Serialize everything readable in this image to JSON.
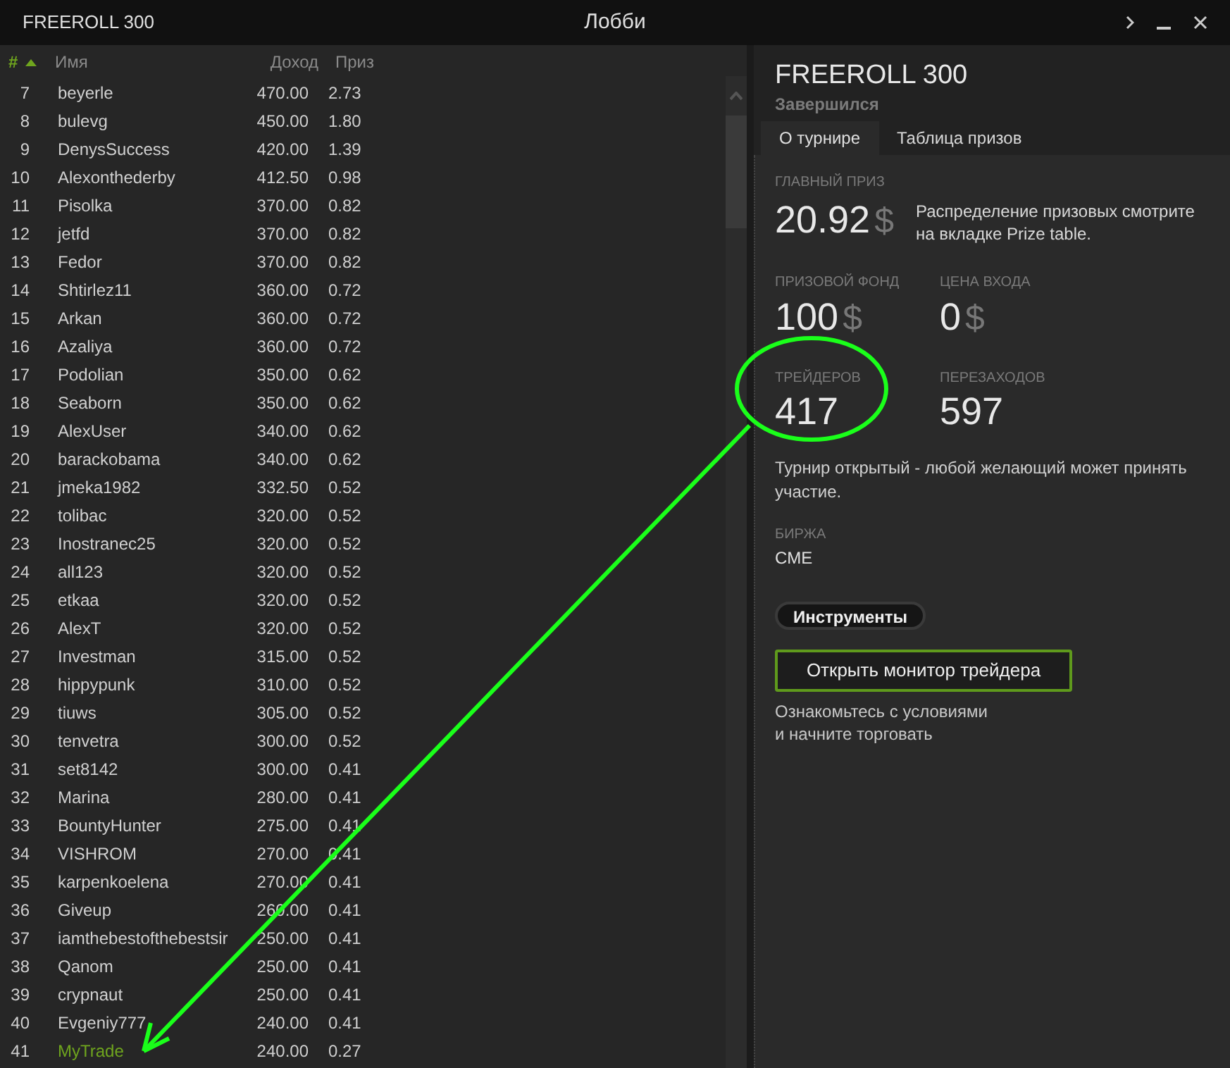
{
  "window": {
    "title": "FREEROLL 300",
    "heading": "Лобби"
  },
  "table": {
    "columns": [
      {
        "label": "#",
        "sorted": true
      },
      {
        "label": "Имя",
        "sorted": false
      },
      {
        "label": "Доход",
        "sorted": false
      },
      {
        "label": "Приз",
        "sorted": false
      }
    ],
    "rows": [
      {
        "rank": "7",
        "name": "beyerle",
        "income": "470.00",
        "prize": "2.73",
        "current": false
      },
      {
        "rank": "8",
        "name": "bulevg",
        "income": "450.00",
        "prize": "1.80",
        "current": false
      },
      {
        "rank": "9",
        "name": "DenysSuccess",
        "income": "420.00",
        "prize": "1.39",
        "current": false
      },
      {
        "rank": "10",
        "name": "Alexonthederby",
        "income": "412.50",
        "prize": "0.98",
        "current": false
      },
      {
        "rank": "11",
        "name": "Pisolka",
        "income": "370.00",
        "prize": "0.82",
        "current": false
      },
      {
        "rank": "12",
        "name": "jetfd",
        "income": "370.00",
        "prize": "0.82",
        "current": false
      },
      {
        "rank": "13",
        "name": "Fedor",
        "income": "370.00",
        "prize": "0.82",
        "current": false
      },
      {
        "rank": "14",
        "name": "Shtirlez11",
        "income": "360.00",
        "prize": "0.72",
        "current": false
      },
      {
        "rank": "15",
        "name": "Arkan",
        "income": "360.00",
        "prize": "0.72",
        "current": false
      },
      {
        "rank": "16",
        "name": "Azaliya",
        "income": "360.00",
        "prize": "0.72",
        "current": false
      },
      {
        "rank": "17",
        "name": "Podolian",
        "income": "350.00",
        "prize": "0.62",
        "current": false
      },
      {
        "rank": "18",
        "name": "Seaborn",
        "income": "350.00",
        "prize": "0.62",
        "current": false
      },
      {
        "rank": "19",
        "name": "AlexUser",
        "income": "340.00",
        "prize": "0.62",
        "current": false
      },
      {
        "rank": "20",
        "name": "barackobama",
        "income": "340.00",
        "prize": "0.62",
        "current": false
      },
      {
        "rank": "21",
        "name": "jmeka1982",
        "income": "332.50",
        "prize": "0.52",
        "current": false
      },
      {
        "rank": "22",
        "name": "tolibac",
        "income": "320.00",
        "prize": "0.52",
        "current": false
      },
      {
        "rank": "23",
        "name": "Inostranec25",
        "income": "320.00",
        "prize": "0.52",
        "current": false
      },
      {
        "rank": "24",
        "name": "all123",
        "income": "320.00",
        "prize": "0.52",
        "current": false
      },
      {
        "rank": "25",
        "name": "etkaa",
        "income": "320.00",
        "prize": "0.52",
        "current": false
      },
      {
        "rank": "26",
        "name": "AlexT",
        "income": "320.00",
        "prize": "0.52",
        "current": false
      },
      {
        "rank": "27",
        "name": "Investman",
        "income": "315.00",
        "prize": "0.52",
        "current": false
      },
      {
        "rank": "28",
        "name": "hippypunk",
        "income": "310.00",
        "prize": "0.52",
        "current": false
      },
      {
        "rank": "29",
        "name": "tiuws",
        "income": "305.00",
        "prize": "0.52",
        "current": false
      },
      {
        "rank": "30",
        "name": "tenvetra",
        "income": "300.00",
        "prize": "0.52",
        "current": false
      },
      {
        "rank": "31",
        "name": "set8142",
        "income": "300.00",
        "prize": "0.41",
        "current": false
      },
      {
        "rank": "32",
        "name": "Marina",
        "income": "280.00",
        "prize": "0.41",
        "current": false
      },
      {
        "rank": "33",
        "name": "BountyHunter",
        "income": "275.00",
        "prize": "0.41",
        "current": false
      },
      {
        "rank": "34",
        "name": "VISHROM",
        "income": "270.00",
        "prize": "0.41",
        "current": false
      },
      {
        "rank": "35",
        "name": "karpenkoelena",
        "income": "270.00",
        "prize": "0.41",
        "current": false
      },
      {
        "rank": "36",
        "name": "Giveup",
        "income": "260.00",
        "prize": "0.41",
        "current": false
      },
      {
        "rank": "37",
        "name": "iamthebestofthebestsir",
        "income": "250.00",
        "prize": "0.41",
        "current": false
      },
      {
        "rank": "38",
        "name": "Qanom",
        "income": "250.00",
        "prize": "0.41",
        "current": false
      },
      {
        "rank": "39",
        "name": "crypnaut",
        "income": "250.00",
        "prize": "0.41",
        "current": false
      },
      {
        "rank": "40",
        "name": "Evgeniy777",
        "income": "240.00",
        "prize": "0.41",
        "current": false
      },
      {
        "rank": "41",
        "name": "MyTrade",
        "income": "240.00",
        "prize": "0.27",
        "current": true
      }
    ]
  },
  "details": {
    "title": "FREEROLL 300",
    "status": "Завершился",
    "tabs": [
      {
        "label": "О турнире",
        "selected": true
      },
      {
        "label": "Таблица призов",
        "selected": false
      }
    ],
    "main_prize": {
      "label": "ГЛАВНЫЙ ПРИЗ",
      "value": "20.92",
      "currency": "$",
      "note": "Распределение призовых смотрите на вкладке Prize table."
    },
    "stats": [
      {
        "label": "ПРИЗОВОЙ ФОНД",
        "value": "100",
        "currency": "$"
      },
      {
        "label": "ЦЕНА ВХОДА",
        "value": "0",
        "currency": "$"
      },
      {
        "label": "ТРЕЙДЕРОВ",
        "value": "417"
      },
      {
        "label": "ПЕРЕЗАХОДОВ",
        "value": "597"
      }
    ],
    "access_note": "Турнир открытый - любой желающий может принять участие.",
    "exchange": {
      "label": "БИРЖА",
      "value": "CME"
    },
    "instruments_button": "Инструменты",
    "monitor_button": "Открыть монитор трейдера",
    "hint": [
      "Ознакомьтесь с условиями",
      "и начните торговать"
    ]
  }
}
